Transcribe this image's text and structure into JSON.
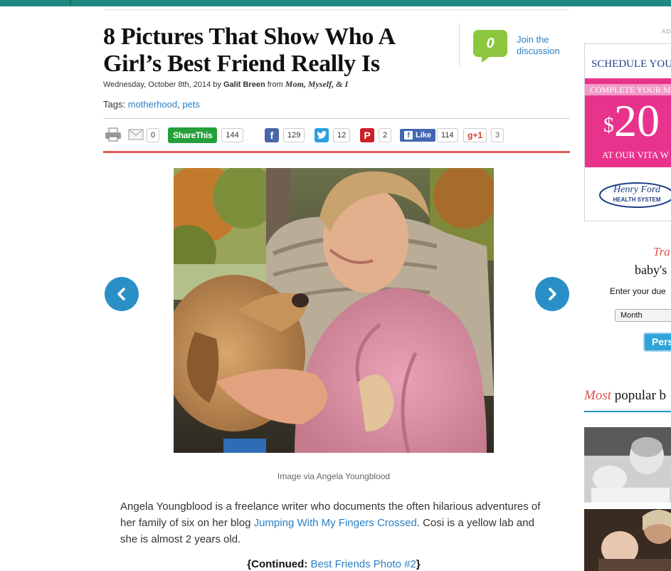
{
  "article": {
    "title_line1": "8 Pictures That Show Who A",
    "title_line2": "Girl’s Best Friend Really Is",
    "date": "Wednesday, October 8th, 2014 by ",
    "author": "Galit Breen",
    "from": " from ",
    "blog": "Mom, Myself, & I",
    "tags_label": "Tags: ",
    "tags": [
      "motherhood",
      "pets"
    ],
    "tag_sep": ", "
  },
  "discussion": {
    "bubble_text": "0",
    "line1": "Join the",
    "line2": "discussion"
  },
  "share": {
    "email_count": "0",
    "sharethis_label": "ShareThis",
    "sharethis_count": "144",
    "facebook_count": "129",
    "twitter_count": "12",
    "pinterest_count": "2",
    "like_label": "Like",
    "like_count": "114",
    "gplus_label": "g+1",
    "gplus_count": "3"
  },
  "photo": {
    "caption": "Image via Angela Youngblood"
  },
  "body": {
    "p1_before": "Angela Youngblood is a freelance writer who documents the often hilarious adventures of her family of six on her blog ",
    "p1_link": "Jumping With My Fingers Crossed",
    "p1_after": ". Cosi is a yellow lab and she is almost 2 years old.",
    "continued_open": "{Continued: ",
    "continued_link": "Best Friends Photo #2",
    "continued_close": "}"
  },
  "ad": {
    "label": "AD",
    "line1": "SCHEDULE YOUR",
    "line2": "COMPLETE YOUR MA",
    "amount_symbol": "$",
    "amount": "20",
    "line3": "AT OUR VITA W",
    "logo_line1": "Henry Ford",
    "logo_line2": "HEALTH SYSTEM"
  },
  "tracker": {
    "title": "Tra",
    "subtitle": "baby's",
    "enter": "Enter your due",
    "month_placeholder": "Month",
    "button": "Pers"
  },
  "most_popular": {
    "most": "Most",
    "rest": " popular b"
  },
  "colors": {
    "accent_blue": "#2a8fc7",
    "brand_teal": "#1e8a82",
    "link": "#2a7fc4",
    "share_rule": "#e05a5a",
    "ad_pink": "#e8338c"
  }
}
